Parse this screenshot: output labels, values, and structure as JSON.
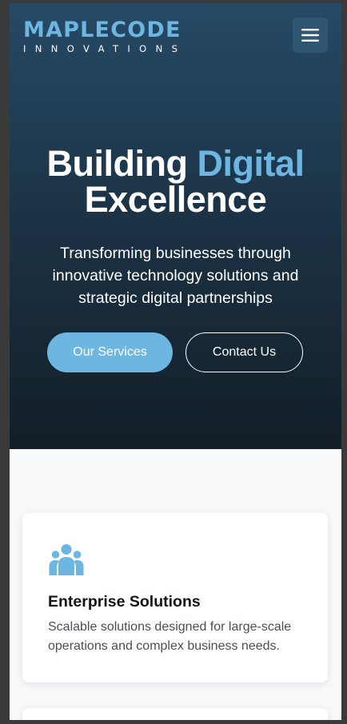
{
  "header": {
    "logo_main": "MAPLECODE",
    "logo_sub": "INNOVATIONS",
    "menu_icon": "hamburger-menu-icon"
  },
  "hero": {
    "title_part1": "Building ",
    "title_accent": "Digital",
    "title_part2": "Excellence",
    "subtitle": "Transforming businesses through innovative technology solutions and strategic digital partnerships",
    "primary_button": "Our Services",
    "secondary_button": "Contact Us"
  },
  "services": [
    {
      "icon": "users-group-icon",
      "title": "Enterprise Solutions",
      "description": "Scalable solutions designed for large-scale operations and complex business needs."
    }
  ],
  "colors": {
    "accent": "#6cb6e1",
    "hero_top": "#264a66",
    "hero_bottom": "#131e27",
    "page_background": "#f7f9fb",
    "card_background": "#ffffff"
  }
}
